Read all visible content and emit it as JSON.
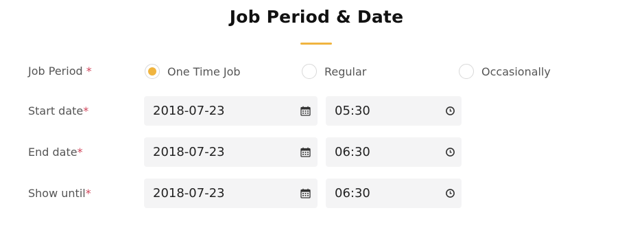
{
  "title": "Job Period & Date",
  "colors": {
    "accent": "#f0b43f",
    "required": "#d0455b",
    "field_bg": "#f4f4f5"
  },
  "job_period": {
    "label": "Job Period",
    "required_mark": "*",
    "options": [
      {
        "label": "One Time Job",
        "selected": true
      },
      {
        "label": "Regular",
        "selected": false
      },
      {
        "label": "Occasionally",
        "selected": false
      }
    ]
  },
  "rows": [
    {
      "label": "Start date",
      "required_mark": "*",
      "date": "2018-07-23",
      "time": "05:30"
    },
    {
      "label": "End date",
      "required_mark": "*",
      "date": "2018-07-23",
      "time": "06:30"
    },
    {
      "label": "Show until",
      "required_mark": "*",
      "date": "2018-07-23",
      "time": "06:30"
    }
  ],
  "icons": {
    "date": "calendar-icon",
    "time": "clock-icon"
  }
}
